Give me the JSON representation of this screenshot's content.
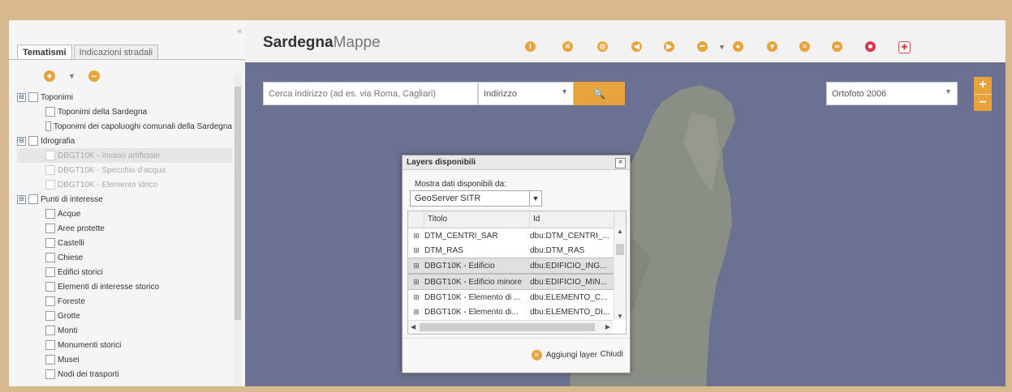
{
  "left_panel": {
    "collapse_label": "«",
    "tabs": [
      {
        "label": "Tematismi"
      },
      {
        "label": "Indicazioni stradali"
      }
    ],
    "tree": [
      {
        "label": "Toponimi",
        "level": 0,
        "expander": "⊟"
      },
      {
        "label": "Toponimi della Sardegna",
        "level": 1
      },
      {
        "label": "Toponimi dei capoluoghi comunali della Sardegna",
        "level": 1
      },
      {
        "label": "Idrografia",
        "level": 0,
        "expander": "⊟"
      },
      {
        "label": "DBGT10K - Invaso artificiale",
        "level": 1,
        "disabled": true,
        "selected": true
      },
      {
        "label": "DBGT10K - Specchio d'acqua",
        "level": 1,
        "disabled": true
      },
      {
        "label": "DBGT10K - Elemento idrico",
        "level": 1,
        "disabled": true
      },
      {
        "label": "Punti di interesse",
        "level": 0,
        "expander": "⊟"
      },
      {
        "label": "Acque",
        "level": 1
      },
      {
        "label": "Aree protette",
        "level": 1
      },
      {
        "label": "Castelli",
        "level": 1
      },
      {
        "label": "Chiese",
        "level": 1
      },
      {
        "label": "Edifici storici",
        "level": 1
      },
      {
        "label": "Elementi di interesse storico",
        "level": 1
      },
      {
        "label": "Foreste",
        "level": 1
      },
      {
        "label": "Grotte",
        "level": 1
      },
      {
        "label": "Monti",
        "level": 1
      },
      {
        "label": "Monumenti storici",
        "level": 1
      },
      {
        "label": "Musei",
        "level": 1
      },
      {
        "label": "Nodi dei trasporti",
        "level": 1
      }
    ]
  },
  "header": {
    "brand_bold": "Sardegna",
    "brand_light": "Mappe"
  },
  "toolbar_icons": [
    "info-icon",
    "zoom-extent-icon",
    "globe-icon",
    "arrow-left-icon",
    "arrow-right-icon",
    "measure-icon",
    "pin-icon",
    "print-icon",
    "layers-icon",
    "link-icon",
    "lock-icon",
    "sardinia-shield-icon"
  ],
  "search": {
    "placeholder": "Cerca indirizzo (ad es. via Roma, Cagliari)",
    "type_value": "Indirizzo",
    "button_icon": "🔍"
  },
  "basemap": {
    "value": "Ortofoto 2006"
  },
  "zoom": {
    "in": "+",
    "out": "−"
  },
  "dialog": {
    "title": "Layers disponibili",
    "close": "×",
    "source_label": "Mostra dati disponibili da:",
    "source_value": "GeoServer SITR",
    "columns": {
      "title": "Titolo",
      "id": "Id"
    },
    "rows": [
      {
        "title": "DTM_CENTRI_SAR",
        "id": "dbu:DTM_CENTRI_..."
      },
      {
        "title": "DTM_RAS",
        "id": "dbu:DTM_RAS"
      },
      {
        "title": "DBGT10K - Edificio",
        "id": "dbu:EDIFICIO_ING...",
        "selected": true
      },
      {
        "title": "DBGT10K - Edificio minore",
        "id": "dbu:EDIFICIO_MIN...",
        "selected": true
      },
      {
        "title": "DBGT10K - Elemento di ...",
        "id": "dbu:ELEMENTO_C..."
      },
      {
        "title": "DBGT10K - Elemento di...",
        "id": "dbu:ELEMENTO_DI..."
      }
    ],
    "add_label": "Aggiungi layer",
    "close_label": "Chiudi"
  }
}
